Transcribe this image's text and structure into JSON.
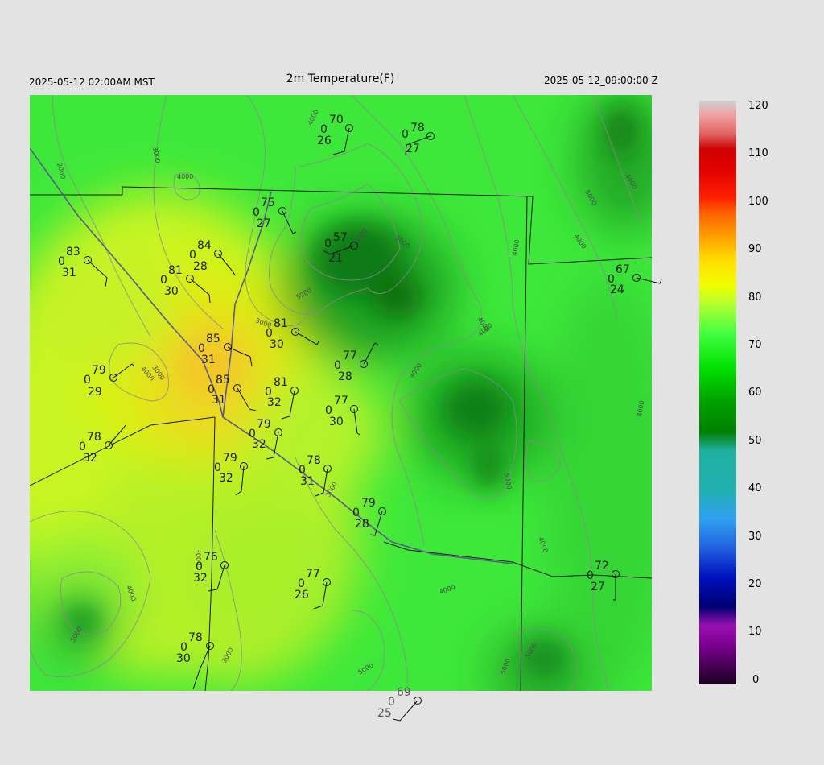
{
  "header": {
    "local_time": "2025-05-12 02:00AM MST",
    "title": "2m Temperature(F)",
    "utc_time": "2025-05-12_09:00:00 Z"
  },
  "colorbar": {
    "labels": [
      "120",
      "110",
      "100",
      "90",
      "80",
      "70",
      "60",
      "50",
      "40",
      "30",
      "20",
      "10",
      "0"
    ],
    "stops": [
      {
        "value": 0,
        "color": "#1a0020"
      },
      {
        "value": 8,
        "color": "#7a0090"
      },
      {
        "value": 12,
        "color": "#9a10b0"
      },
      {
        "value": 16,
        "color": "#000070"
      },
      {
        "value": 22,
        "color": "#0010c0"
      },
      {
        "value": 28,
        "color": "#2060e0"
      },
      {
        "value": 34,
        "color": "#30a0f0"
      },
      {
        "value": 40,
        "color": "#20b0b0"
      },
      {
        "value": 48,
        "color": "#20b0a0"
      },
      {
        "value": 52,
        "color": "#008000"
      },
      {
        "value": 58,
        "color": "#00a000"
      },
      {
        "value": 65,
        "color": "#00e000"
      },
      {
        "value": 72,
        "color": "#40ff40"
      },
      {
        "value": 78,
        "color": "#b0ff30"
      },
      {
        "value": 82,
        "color": "#f0ff00"
      },
      {
        "value": 87,
        "color": "#ffe000"
      },
      {
        "value": 92,
        "color": "#ffa000"
      },
      {
        "value": 97,
        "color": "#ff6000"
      },
      {
        "value": 100,
        "color": "#ff2000"
      },
      {
        "value": 106,
        "color": "#e00000"
      },
      {
        "value": 110,
        "color": "#d00000"
      },
      {
        "value": 113,
        "color": "#e06060"
      },
      {
        "value": 117,
        "color": "#f0a0a0"
      },
      {
        "value": 120,
        "color": "#d0d0d0"
      }
    ]
  },
  "contour_labels": [
    "2000",
    "3000",
    "4000",
    "4000",
    "3000",
    "5000",
    "5000",
    "5000",
    "4000",
    "3000",
    "4000",
    "4000",
    "5000",
    "4000",
    "4000",
    "3000",
    "3000",
    "4000",
    "4000",
    "5000",
    "5000",
    "5000",
    "3000",
    "5000",
    "4000",
    "5000",
    "4000",
    "4000",
    "4000"
  ],
  "stations": [
    {
      "temp": "70",
      "dew": "26",
      "sky": "0"
    },
    {
      "temp": "78",
      "dew": "27",
      "sky": "0"
    },
    {
      "temp": "75",
      "dew": "27",
      "sky": "0"
    },
    {
      "temp": "57",
      "dew": "21",
      "sky": "0"
    },
    {
      "temp": "83",
      "dew": "31",
      "sky": "0"
    },
    {
      "temp": "84",
      "dew": "28",
      "sky": "0"
    },
    {
      "temp": "81",
      "dew": "30",
      "sky": "0"
    },
    {
      "temp": "67",
      "dew": "24",
      "sky": "0"
    },
    {
      "temp": "81",
      "dew": "30",
      "sky": "0"
    },
    {
      "temp": "85",
      "dew": "31",
      "sky": "0"
    },
    {
      "temp": "77",
      "dew": "28",
      "sky": "0"
    },
    {
      "temp": "79",
      "dew": "29",
      "sky": "0"
    },
    {
      "temp": "85",
      "dew": "31",
      "sky": "0"
    },
    {
      "temp": "81",
      "dew": "32",
      "sky": "0"
    },
    {
      "temp": "77",
      "dew": "30",
      "sky": "0"
    },
    {
      "temp": "78",
      "dew": "32",
      "sky": "0"
    },
    {
      "temp": "79",
      "dew": "32",
      "sky": "0"
    },
    {
      "temp": "79",
      "dew": "32",
      "sky": "0"
    },
    {
      "temp": "78",
      "dew": "31",
      "sky": "0"
    },
    {
      "temp": "79",
      "dew": "28",
      "sky": "0"
    },
    {
      "temp": "76",
      "dew": "32",
      "sky": "0"
    },
    {
      "temp": "77",
      "dew": "26",
      "sky": "0"
    },
    {
      "temp": "72",
      "dew": "27",
      "sky": "0"
    },
    {
      "temp": "78",
      "dew": "30",
      "sky": "0"
    },
    {
      "temp": "69",
      "dew": "25",
      "sky": "0"
    }
  ]
}
